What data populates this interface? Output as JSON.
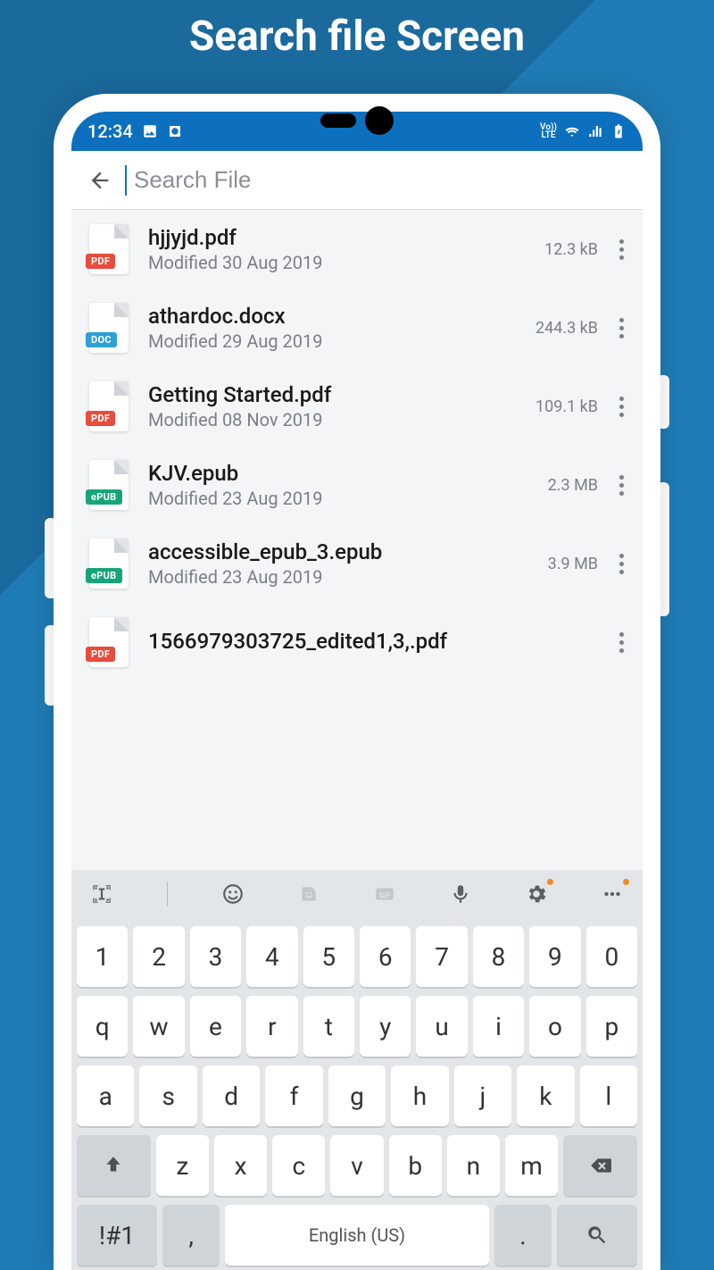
{
  "headline": "Search file Screen",
  "status": {
    "time": "12:34",
    "lte": "Vo))\nLTE"
  },
  "search": {
    "placeholder": "Search File",
    "value": ""
  },
  "files": [
    {
      "name": "hjjyjd.pdf",
      "modified": "Modified 30 Aug 2019",
      "size": "12.3 kB",
      "type": "pdf",
      "tag": "PDF"
    },
    {
      "name": "athardoc.docx",
      "modified": "Modified 29 Aug 2019",
      "size": "244.3 kB",
      "type": "doc",
      "tag": "DOC"
    },
    {
      "name": "Getting Started.pdf",
      "modified": "Modified 08 Nov 2019",
      "size": "109.1 kB",
      "type": "pdf",
      "tag": "PDF"
    },
    {
      "name": "KJV.epub",
      "modified": "Modified 23 Aug 2019",
      "size": "2.3 MB",
      "type": "epub",
      "tag": "ePUB"
    },
    {
      "name": "accessible_epub_3.epub",
      "modified": "Modified 23 Aug 2019",
      "size": "3.9 MB",
      "type": "epub",
      "tag": "ePUB"
    },
    {
      "name": "1566979303725_edited1,3,.pdf",
      "modified": "",
      "size": "",
      "type": "pdf",
      "tag": "PDF"
    }
  ],
  "keyboard": {
    "rows": [
      [
        "1",
        "2",
        "3",
        "4",
        "5",
        "6",
        "7",
        "8",
        "9",
        "0"
      ],
      [
        "q",
        "w",
        "e",
        "r",
        "t",
        "y",
        "u",
        "i",
        "o",
        "p"
      ],
      [
        "a",
        "s",
        "d",
        "f",
        "g",
        "h",
        "j",
        "k",
        "l"
      ],
      [
        "z",
        "x",
        "c",
        "v",
        "b",
        "n",
        "m"
      ]
    ],
    "bottom": {
      "sym": "!#1",
      "comma": ",",
      "space": "English (US)",
      "period": "."
    }
  }
}
